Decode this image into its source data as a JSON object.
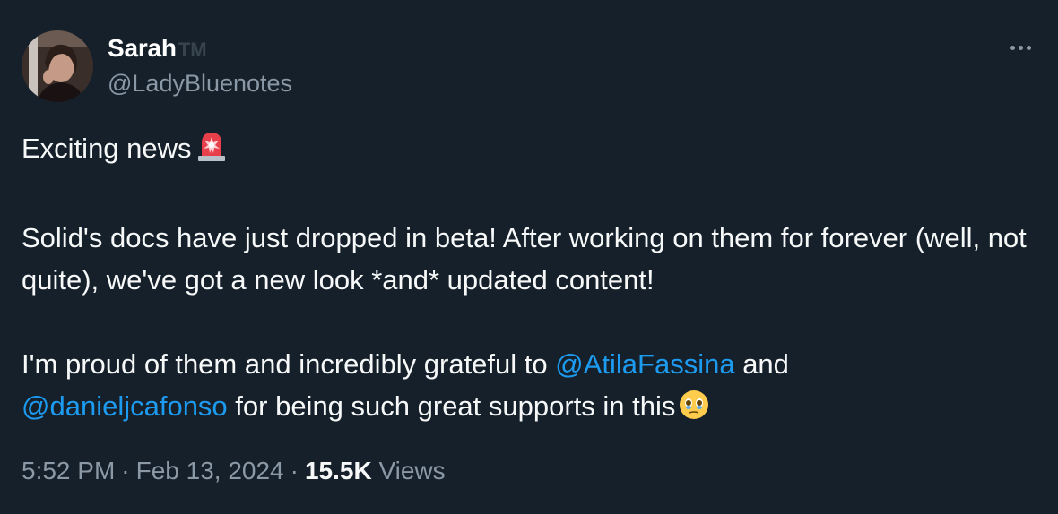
{
  "author": {
    "display_name": "Sarah",
    "badge": "TM",
    "handle": "@LadyBluenotes",
    "avatar_icon": "profile-photo"
  },
  "menu_icon": "more-options-icon",
  "post": {
    "line1": "Exciting news",
    "line1_emoji": "police-car-light-emoji",
    "para2": "Solid's docs have just dropped in beta! After working on them for forever (well, not quite), we've got a new look *and* updated content!",
    "para3_start": "I'm proud of them and incredibly grateful to ",
    "mention1": "@AtilaFassina",
    "para3_mid": " and",
    "mention2": "@danieljcafonso",
    "para3_end": " for being such great supports in this",
    "para3_emoji": "holding-back-tears-emoji"
  },
  "meta": {
    "time": "5:52 PM",
    "date": "Feb 13, 2024",
    "separator": "·",
    "views_count": "15.5K",
    "views_label": "Views"
  },
  "colors": {
    "background": "#15202b",
    "text": "#f7f9f9",
    "muted": "#8b98a5",
    "link": "#1d9bf0"
  }
}
